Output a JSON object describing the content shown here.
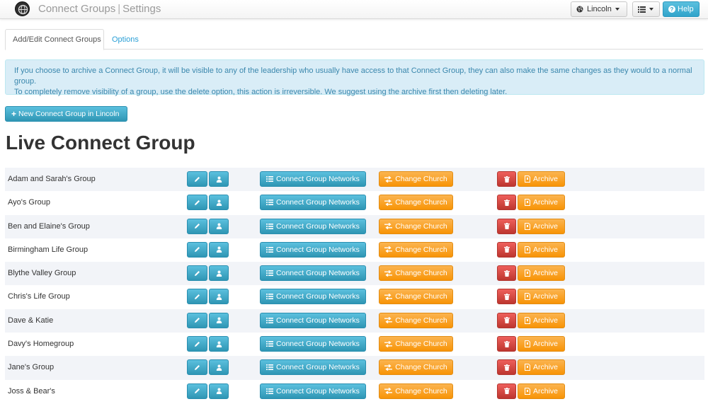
{
  "navbar": {
    "brand_primary": "Connect Groups",
    "brand_separator": "|",
    "brand_secondary": "Settings",
    "church_label": "Lincoln",
    "help_label": "Help"
  },
  "tabs": [
    {
      "label": "Add/Edit Connect Groups",
      "active": true
    },
    {
      "label": "Options",
      "active": false
    }
  ],
  "alert": {
    "line1": "If you choose to archive a Connect Group, it will be visible to any of the leadership who usually have access to that Connect Group, they can also make the same changes as they would to a normal group.",
    "line2": "To completely remove visibility of a group, use the delete option, this action is irreversible. We suggest using the archive first then deleting later."
  },
  "new_group_button": "New Connect Group in Lincoln",
  "page_title": "Live Connect Group",
  "row_actions": {
    "networks_label": "Connect Group Networks",
    "change_church_label": "Change Church",
    "archive_label": "Archive"
  },
  "groups": [
    "Adam and Sarah's Group",
    "Ayo's Group",
    "Ben and Elaine's Group",
    "Birmingham Life Group",
    "Blythe Valley Group",
    "Chris's Life Group",
    "Dave & Katie",
    "Davy's Homegroup",
    "Jane's Group",
    "Joss & Bear's"
  ],
  "icons": {
    "logo": "globe-logo-icon",
    "church": "globe-icon",
    "apps": "list-icon",
    "help": "question-circle-icon",
    "new": "plus-icon",
    "edit": "pencil-icon",
    "user": "user-icon",
    "networks": "list-icon",
    "change_church": "exchange-arrows-icon",
    "delete": "trash-icon",
    "archive": "archive-file-icon"
  },
  "colors": {
    "info": "#5bc0de",
    "warning": "#f89406",
    "danger": "#d9534f",
    "alert_bg": "#d9edf7",
    "alert_text": "#3a87ad",
    "link": "#2a9fd6"
  }
}
